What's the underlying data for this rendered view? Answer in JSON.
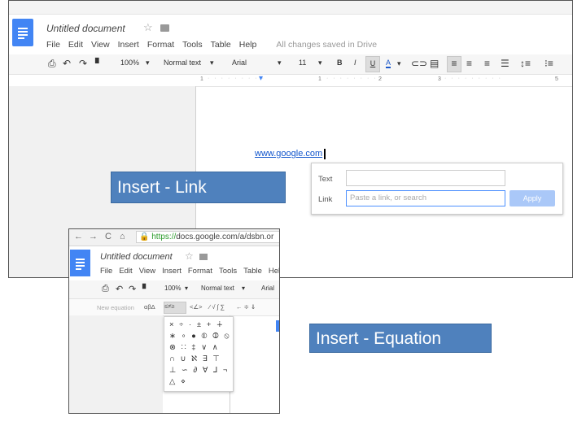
{
  "top_shot": {
    "doc_title": "Untitled document",
    "star_icon": "☆",
    "menu": [
      "File",
      "Edit",
      "View",
      "Insert",
      "Format",
      "Tools",
      "Table",
      "Help"
    ],
    "saved_status": "All changes saved in Drive",
    "toolbar": {
      "zoom": "100%",
      "style": "Normal text",
      "font": "Arial",
      "size": "11",
      "bold": "B",
      "italic": "I",
      "underline": "U",
      "text_color": "A"
    },
    "ruler_marks": [
      "1",
      "1",
      "2",
      "3",
      "5"
    ],
    "link_text": "www.google.com",
    "popup": {
      "text_label": "Text",
      "link_label": "Link",
      "link_placeholder": "Paste a link, or search",
      "apply_label": "Apply"
    }
  },
  "labels": {
    "insert_link": "Insert - Link",
    "insert_equation": "Insert - Equation"
  },
  "bottom_shot": {
    "nav": {
      "back": "←",
      "forward": "→",
      "reload": "C",
      "home": "⌂",
      "url_prefix": "https://",
      "url_rest": "docs.google.com/a/dsbn.or"
    },
    "doc_title": "Untitled document",
    "star_icon": "☆",
    "menu": [
      "File",
      "Edit",
      "View",
      "Insert",
      "Format",
      "Tools",
      "Table",
      "Help"
    ],
    "toolbar": {
      "zoom": "100%",
      "style": "Normal text",
      "font": "Arial"
    },
    "equation_bar": {
      "new_equation": "New equation",
      "groups": [
        "αβΔ",
        "≤≠≥",
        "<∠>",
        "∕ √ ∫ ∑",
        "← ≑ ⇓"
      ]
    },
    "palette_rows": [
      "× ÷ · ± + ∔",
      "∗ ∘ ● ⦶ ⦷ ⦸",
      "⊗ ∷ ‡ ∨ ∧",
      "∩ ∪ ℵ ∃ ⊤",
      "⊥ ∽ ∂ ∀ ⅃ ¬",
      "△ ⋄"
    ]
  },
  "colors": {
    "docs_blue": "#4285f4",
    "label_blue": "#4f81bd",
    "link_blue": "#1155cc"
  }
}
